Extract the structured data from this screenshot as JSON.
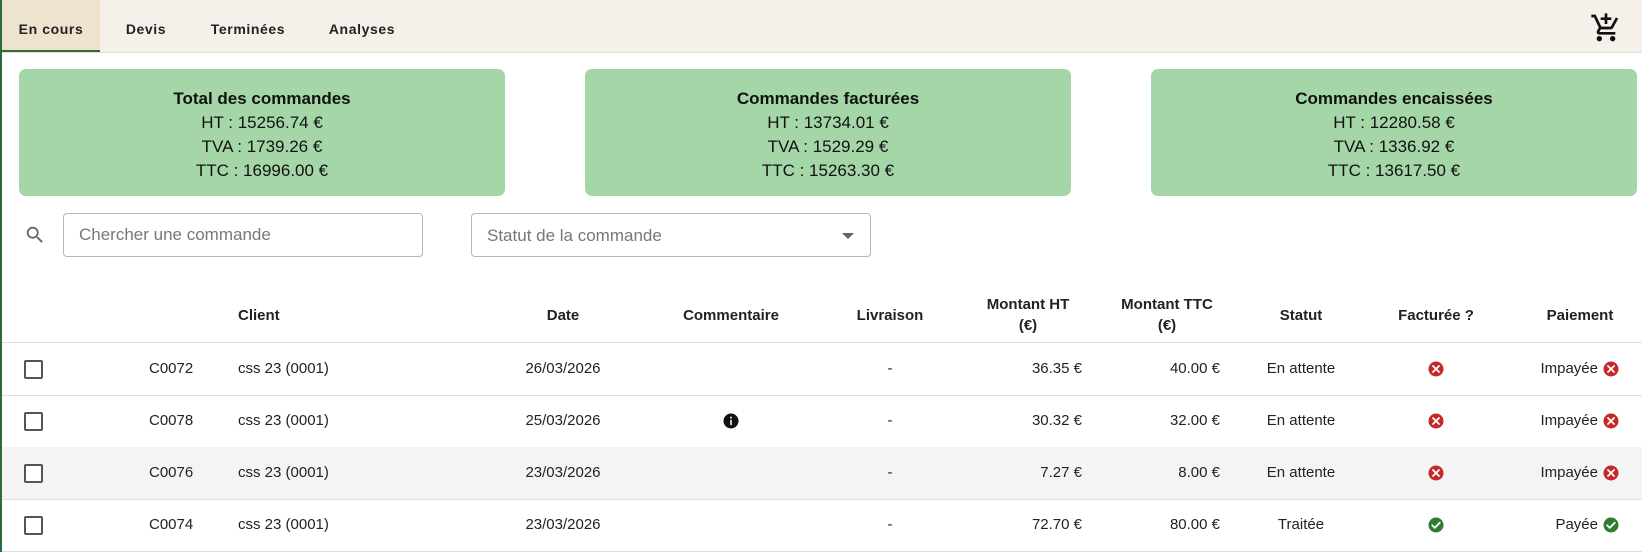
{
  "tabs": [
    {
      "label": "En cours",
      "active": true
    },
    {
      "label": "Devis",
      "active": false
    },
    {
      "label": "Terminées",
      "active": false
    },
    {
      "label": "Analyses",
      "active": false
    }
  ],
  "summary": [
    {
      "title": "Total des commandes",
      "ht": "HT : 15256.74 €",
      "tva": "TVA : 1739.26 €",
      "ttc": "TTC : 16996.00 €"
    },
    {
      "title": "Commandes facturées",
      "ht": "HT : 13734.01 €",
      "tva": "TVA : 1529.29 €",
      "ttc": "TTC : 15263.30 €"
    },
    {
      "title": "Commandes encaissées",
      "ht": "HT : 12280.58 €",
      "tva": "TVA : 1336.92 €",
      "ttc": "TTC : 13617.50 €"
    }
  ],
  "filters": {
    "search_placeholder": "Chercher une commande",
    "status_placeholder": "Statut de la commande"
  },
  "table": {
    "headers": {
      "client": "Client",
      "date": "Date",
      "comment": "Commentaire",
      "delivery": "Livraison",
      "ht_line1": "Montant HT",
      "ht_line2": "(€)",
      "ttc_line1": "Montant TTC",
      "ttc_line2": "(€)",
      "status": "Statut",
      "invoiced": "Facturée ?",
      "payment": "Paiement"
    },
    "rows": [
      {
        "id": "C0072",
        "client": "css 23 (0001)",
        "date": "26/03/2026",
        "comment_icon": false,
        "delivery": "-",
        "ht": "36.35 €",
        "ttc": "40.00 €",
        "status": "En attente",
        "invoiced": "no",
        "payment": "Impayée",
        "paid": false
      },
      {
        "id": "C0078",
        "client": "css 23 (0001)",
        "date": "25/03/2026",
        "comment_icon": true,
        "delivery": "-",
        "ht": "30.32 €",
        "ttc": "32.00 €",
        "status": "En attente",
        "invoiced": "no",
        "payment": "Impayée",
        "paid": false
      },
      {
        "id": "C0076",
        "client": "css 23 (0001)",
        "date": "23/03/2026",
        "comment_icon": false,
        "delivery": "-",
        "ht": "7.27 €",
        "ttc": "8.00 €",
        "status": "En attente",
        "invoiced": "no",
        "payment": "Impayée",
        "paid": false
      },
      {
        "id": "C0074",
        "client": "css 23 (0001)",
        "date": "23/03/2026",
        "comment_icon": false,
        "delivery": "-",
        "ht": "72.70 €",
        "ttc": "80.00 €",
        "status": "Traitée",
        "invoiced": "yes",
        "payment": "Payée",
        "paid": true
      }
    ]
  },
  "colors": {
    "card_bg": "#a5d6a7",
    "error_red": "#c62828",
    "success_green": "#2e7d32"
  },
  "icons": {
    "cart": "cart-add-icon",
    "search": "search-icon",
    "comment": "info-icon",
    "no": "cancel-circle-icon",
    "yes": "check-circle-icon"
  }
}
